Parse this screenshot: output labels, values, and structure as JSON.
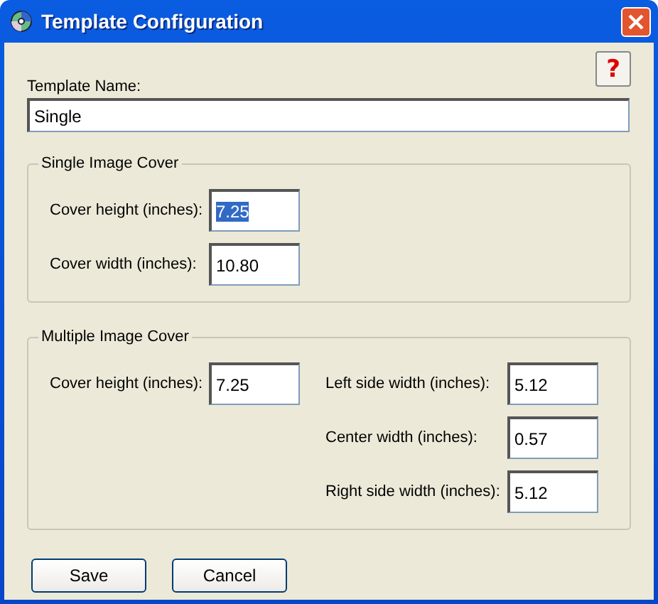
{
  "window": {
    "title": "Template Configuration"
  },
  "help_button": {
    "label": "?"
  },
  "template_name": {
    "label": "Template Name:",
    "value": "Single"
  },
  "single_image_cover": {
    "title": "Single Image Cover",
    "fields": [
      {
        "label": "Cover height (inches):",
        "value": "7.25",
        "highlighted": true
      },
      {
        "label": "Cover width (inches):",
        "value": "10.80",
        "highlighted": false
      }
    ]
  },
  "multiple_image_cover": {
    "title": "Multiple Image Cover",
    "left_fields": [
      {
        "label": "Cover height (inches):",
        "value": "7.25",
        "highlighted": false
      }
    ],
    "right_fields": [
      {
        "label": "Left side width (inches):",
        "value": "5.12",
        "highlighted": false
      },
      {
        "label": "Center width (inches):",
        "value": "0.57",
        "highlighted": false
      },
      {
        "label": "Right side width (inches):",
        "value": "5.12",
        "highlighted": false
      }
    ]
  },
  "buttons": [
    "Save",
    "Cancel"
  ]
}
